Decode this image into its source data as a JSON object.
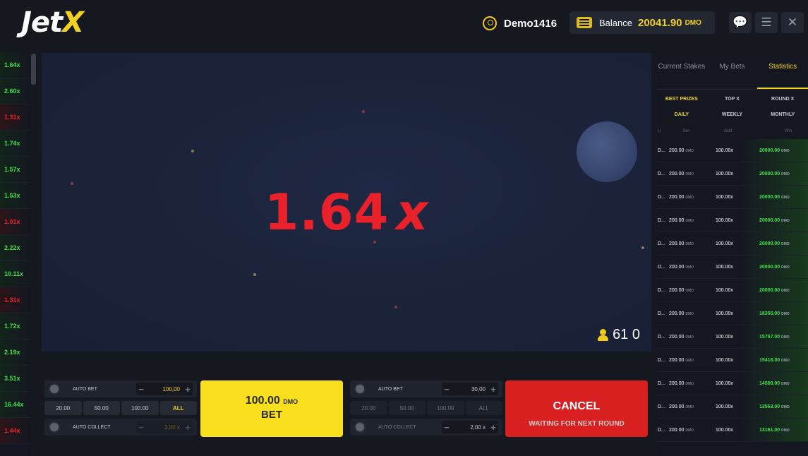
{
  "header": {
    "logo_main": "Jet",
    "logo_x": "X",
    "username": "Demo1416",
    "balance_label": "Balance",
    "balance_value": "20041.90",
    "balance_currency": "DMO"
  },
  "history": [
    {
      "v": "1.64x",
      "c": "#3fe04a"
    },
    {
      "v": "2.60x",
      "c": "#3fe04a"
    },
    {
      "v": "1.31x",
      "c": "#e8212a"
    },
    {
      "v": "1.74x",
      "c": "#3fe04a"
    },
    {
      "v": "1.57x",
      "c": "#3fe04a"
    },
    {
      "v": "1.53x",
      "c": "#3fe04a"
    },
    {
      "v": "1.01x",
      "c": "#e8212a"
    },
    {
      "v": "2.22x",
      "c": "#3fe04a"
    },
    {
      "v": "10.11x",
      "c": "#3fe04a"
    },
    {
      "v": "1.31x",
      "c": "#e8212a"
    },
    {
      "v": "1.72x",
      "c": "#3fe04a"
    },
    {
      "v": "2.19x",
      "c": "#3fe04a"
    },
    {
      "v": "3.51x",
      "c": "#3fe04a"
    },
    {
      "v": "16.44x",
      "c": "#3fe04a"
    },
    {
      "v": "1.44x",
      "c": "#e8212a"
    }
  ],
  "game": {
    "multiplier": "1.64",
    "multiplier_suffix": "x",
    "players": "61 0"
  },
  "bet1": {
    "auto_bet": "AUTO BET",
    "amount": "100,00",
    "quick": [
      "20.00",
      "50.00",
      "100.00",
      "ALL"
    ],
    "auto_collect": "AUTO COLLECT",
    "collect_value": "2,00",
    "collect_suffix": "x"
  },
  "bet_button": {
    "amount": "100.00",
    "currency": "DMO",
    "label": "BET"
  },
  "bet2": {
    "auto_bet": "AUTO BET",
    "amount": "30,00",
    "quick": [
      "20.00",
      "50.00",
      "100.00",
      "ALL"
    ],
    "auto_collect": "AUTO COLLECT",
    "collect_value": "2,00",
    "collect_suffix": "x"
  },
  "cancel_button": {
    "label": "CANCEL",
    "sub": "WAITING FOR NEXT ROUND"
  },
  "right_panel": {
    "tabs": [
      "Current Stakes",
      "My Bets",
      "Statistics"
    ],
    "subtabs": [
      "BEST PRIZES",
      "TOP X",
      "ROUND X"
    ],
    "periods": [
      "DAILY",
      "WEEKLY",
      "MONTHLY"
    ],
    "columns": [
      "U",
      "Bet",
      "Odd",
      "Win"
    ],
    "rows": [
      {
        "u": "D...",
        "bet": "200.00",
        "odd": "100.00x",
        "win": "20000.00"
      },
      {
        "u": "D...",
        "bet": "200.00",
        "odd": "100.00x",
        "win": "20000.00"
      },
      {
        "u": "D...",
        "bet": "200.00",
        "odd": "100.00x",
        "win": "20000.00"
      },
      {
        "u": "D...",
        "bet": "200.00",
        "odd": "100.00x",
        "win": "20000.00"
      },
      {
        "u": "D...",
        "bet": "200.00",
        "odd": "100.00x",
        "win": "20000.00"
      },
      {
        "u": "D...",
        "bet": "200.00",
        "odd": "100.00x",
        "win": "20000.00"
      },
      {
        "u": "D...",
        "bet": "200.00",
        "odd": "100.00x",
        "win": "20000.00"
      },
      {
        "u": "D...",
        "bet": "200.00",
        "odd": "100.00x",
        "win": "18356.00"
      },
      {
        "u": "D...",
        "bet": "200.00",
        "odd": "100.00x",
        "win": "15757.00"
      },
      {
        "u": "D...",
        "bet": "200.00",
        "odd": "100.00x",
        "win": "15418.00"
      },
      {
        "u": "D...",
        "bet": "200.00",
        "odd": "100.00x",
        "win": "14580.00"
      },
      {
        "u": "D...",
        "bet": "200.00",
        "odd": "100.00x",
        "win": "13563.00"
      },
      {
        "u": "D...",
        "bet": "200.00",
        "odd": "100.00x",
        "win": "13161.00"
      }
    ],
    "currency": "DMO"
  }
}
